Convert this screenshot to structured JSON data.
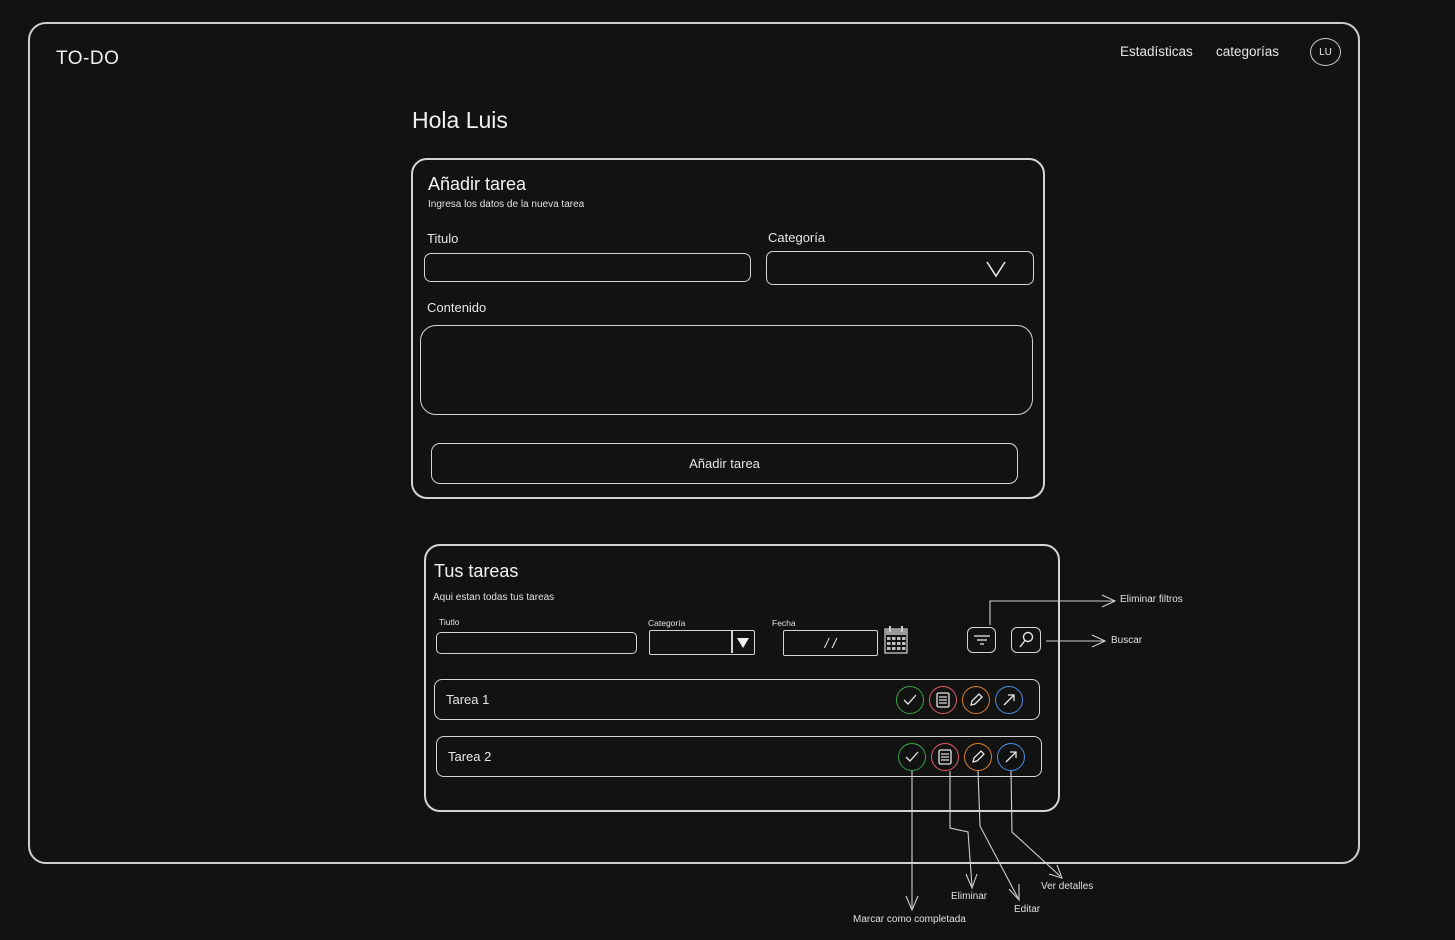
{
  "app": {
    "logo": "TO-DO"
  },
  "nav": {
    "stats": "Estadísticas",
    "categories": "categorías",
    "avatar": "LU"
  },
  "greeting": "Hola Luis",
  "add_task": {
    "title": "Añadir tarea",
    "subtitle": "Ingresa los datos de la nueva tarea",
    "title_label": "Titulo",
    "category_label": "Categoría",
    "content_label": "Contenido",
    "button_label": "Añadir tarea"
  },
  "tasks": {
    "title": "Tus tareas",
    "subtitle": "Aqui estan todas tus tareas",
    "filters": {
      "title_label": "Tiutlo",
      "category_label": "Categoría",
      "date_label": "Fecha",
      "date_placeholder": "/ /"
    },
    "items": [
      {
        "label": "Tarea 1"
      },
      {
        "label": "Tarea 2"
      }
    ]
  },
  "annotations": {
    "clear_filters": "Eliminar filtros",
    "search": "Buscar",
    "mark_complete": "Marcar como completada",
    "delete": "Eliminar",
    "edit": "Editar",
    "details": "Ver detalles"
  },
  "colors": {
    "complete": "#3fa34d",
    "delete": "#e05a6a",
    "edit": "#d9822b",
    "details": "#4a8fe0"
  },
  "icons": [
    "calendar-icon",
    "filter-icon",
    "search-icon",
    "check-icon",
    "delete-icon",
    "edit-icon",
    "details-icon",
    "chevron-down-icon"
  ]
}
